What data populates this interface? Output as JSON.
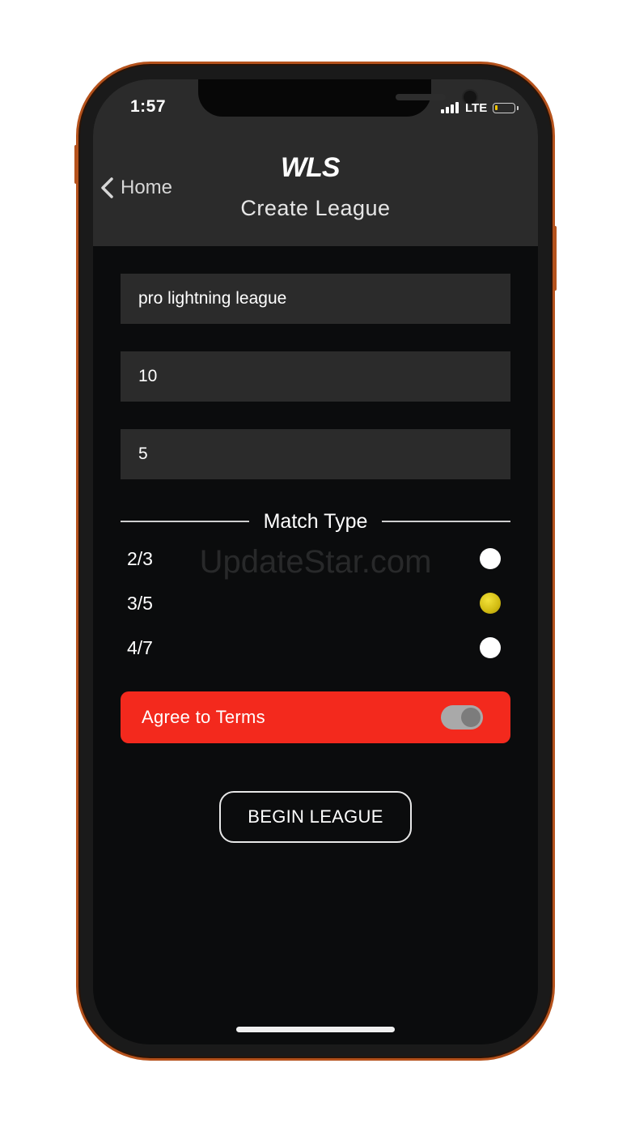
{
  "status_bar": {
    "time": "1:57",
    "network": "LTE",
    "battery_percent": 15,
    "battery_color": "#f2c500"
  },
  "header": {
    "back_label": "Home",
    "back_icon": "chevron-left-icon",
    "logo_text": "WLS",
    "title": "Create League"
  },
  "form": {
    "league_name_value": "pro lightning league",
    "field_two_value": "10",
    "field_three_value": "5"
  },
  "match_type": {
    "title": "Match Type",
    "options": [
      {
        "label": "2/3",
        "selected": false
      },
      {
        "label": "3/5",
        "selected": true
      },
      {
        "label": "4/7",
        "selected": false
      }
    ]
  },
  "terms": {
    "label": "Agree to Terms",
    "toggle_on": true,
    "accent_color": "#f3291d"
  },
  "actions": {
    "begin_label": "BEGIN LEAGUE"
  },
  "watermark": "UpdateStar.com"
}
